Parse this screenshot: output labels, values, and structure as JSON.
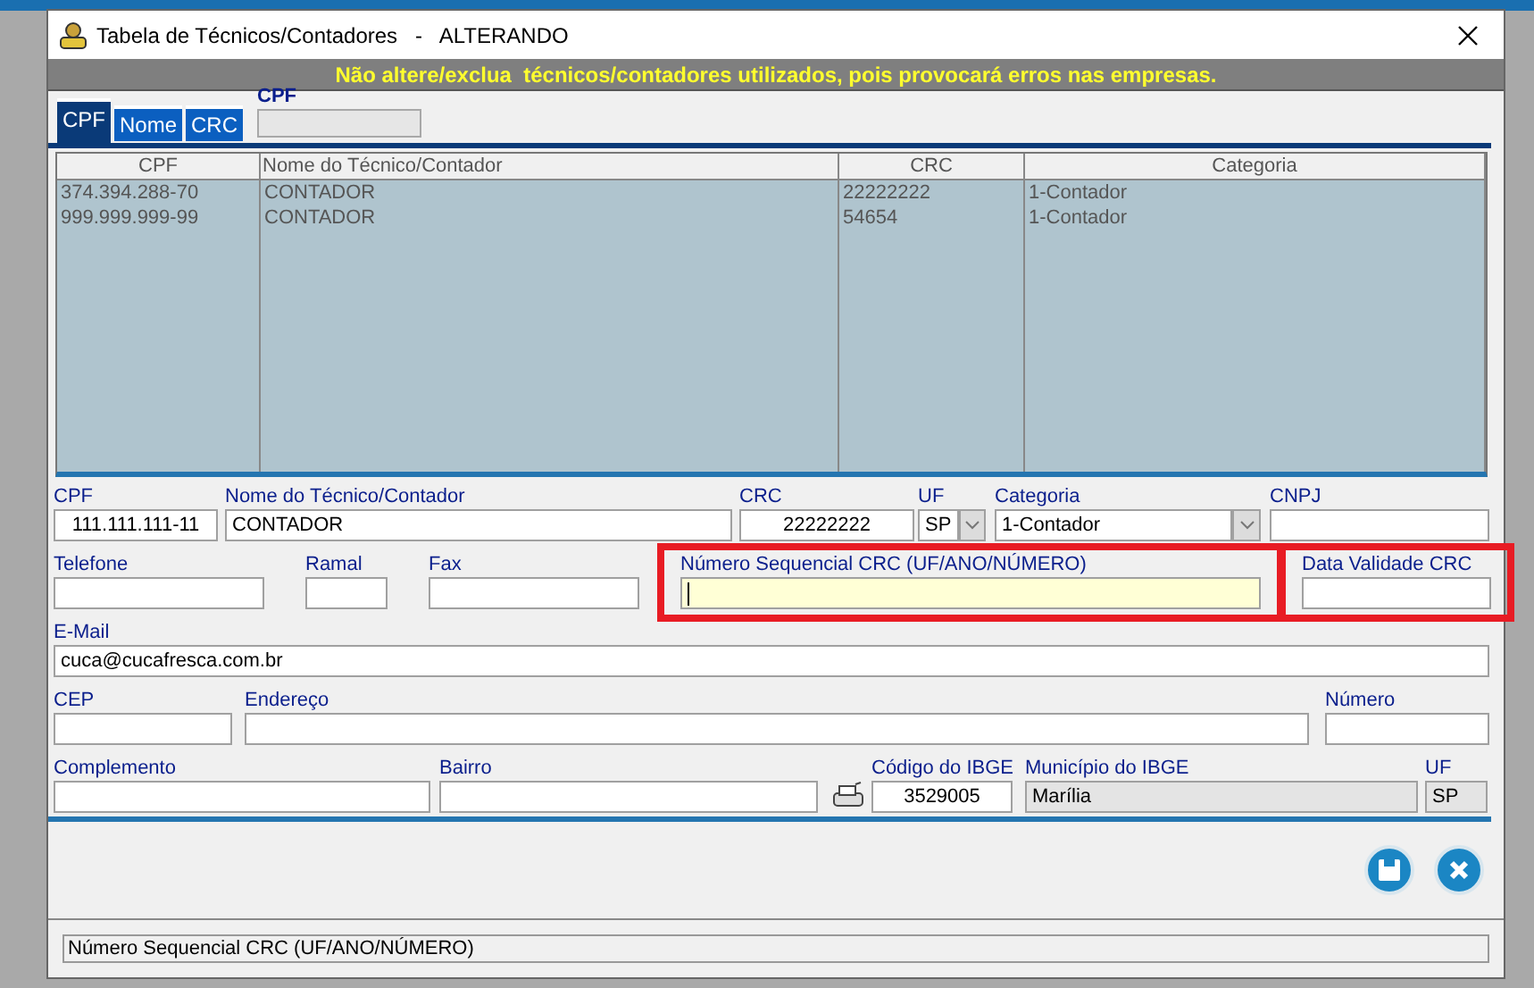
{
  "window": {
    "title": "Tabela de Técnicos/Contadores   -   ALTERANDO"
  },
  "warning": "Não altere/exclua  técnicos/contadores utilizados, pois provocará erros nas empresas.",
  "tabs": [
    {
      "label": "CPF",
      "selected": true
    },
    {
      "label": "Nome",
      "selected": false
    },
    {
      "label": "CRC",
      "selected": false
    }
  ],
  "search": {
    "label": "CPF"
  },
  "table": {
    "columns": [
      "CPF",
      "Nome do Técnico/Contador",
      "CRC",
      "Categoria"
    ],
    "rows": [
      [
        "374.394.288-70",
        "CONTADOR",
        "22222222",
        "1-Contador"
      ],
      [
        "999.999.999-99",
        "CONTADOR",
        "54654",
        "1-Contador"
      ]
    ]
  },
  "form": [
    [
      {
        "kind": "centered",
        "label": "CPF",
        "value": "111.111.111-11"
      },
      {
        "kind": "text",
        "label": "Nome do Técnico/Contador",
        "value": "CONTADOR"
      },
      {
        "kind": "centered",
        "label": "CRC",
        "value": "22222222"
      },
      {
        "kind": "select",
        "label": "UF",
        "value": "SP"
      },
      {
        "kind": "select",
        "label": "Categoria",
        "value": "1-Contador"
      },
      {
        "kind": "text",
        "label": "CNPJ"
      }
    ],
    [
      {
        "kind": "text",
        "label": "Telefone"
      },
      {
        "kind": "text",
        "label": "Ramal"
      },
      {
        "kind": "text",
        "label": "Fax"
      },
      {
        "kind": "text",
        "label": "Número Sequencial CRC (UF/ANO/NÚMERO)",
        "focused": true,
        "highlighted": true
      },
      {
        "kind": "text",
        "label": "Data Validade CRC",
        "highlighted": true
      }
    ],
    [
      {
        "kind": "text",
        "label": "E-Mail",
        "value": "cuca@cucafresca.com.br"
      }
    ],
    [
      {
        "kind": "text",
        "label": "CEP"
      },
      {
        "kind": "text",
        "label": "Endereço"
      },
      {
        "kind": "text",
        "label": "Número"
      }
    ],
    [
      {
        "kind": "text",
        "label": "Complemento"
      },
      {
        "kind": "text",
        "label": "Bairro"
      },
      {
        "kind": "lookup"
      },
      {
        "kind": "centered",
        "label": "Código do IBGE",
        "value": "3529005"
      },
      {
        "kind": "text",
        "label": "Município do IBGE",
        "value": "Marília",
        "disabled": true
      },
      {
        "kind": "text",
        "label": "UF",
        "value": "SP",
        "disabled": true
      }
    ]
  ],
  "status_bar": "Número Sequencial CRC (UF/ANO/NÚMERO)"
}
